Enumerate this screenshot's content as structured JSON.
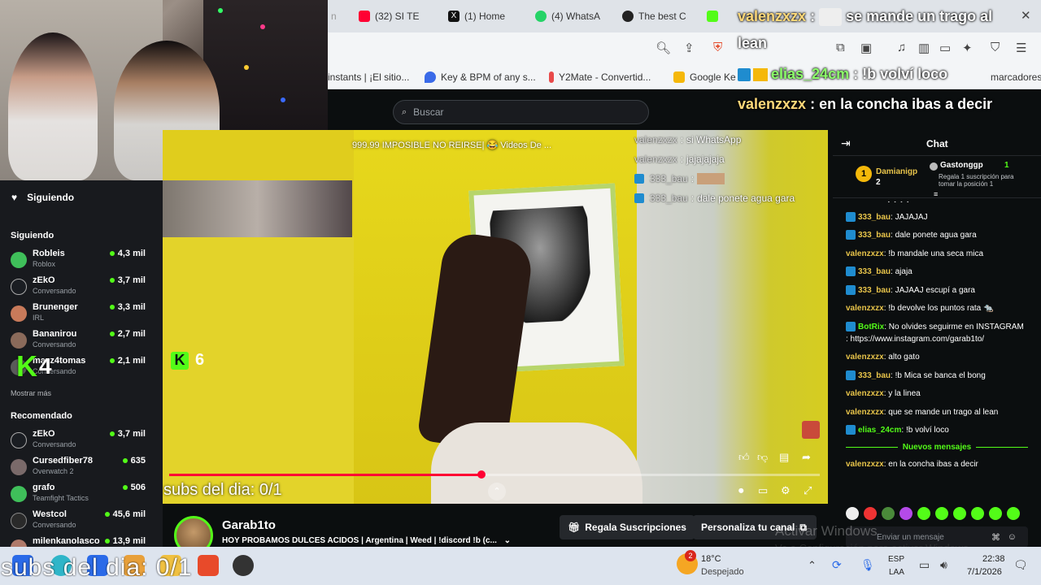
{
  "browser": {
    "tabs": [
      {
        "label": "(32) SI TE",
        "icon": "youtube-icon",
        "color": "#ff0033"
      },
      {
        "label": "(1) Home",
        "icon": "x-icon",
        "color": "#111111"
      },
      {
        "label": "(4) WhatsA",
        "icon": "whatsapp-icon",
        "color": "#25d366"
      },
      {
        "label": "The best C",
        "icon": "github-icon",
        "color": "#222222"
      }
    ],
    "bookmarks": [
      {
        "label": "rinstants | ¡El sitio..."
      },
      {
        "label": "Key & BPM of any s..."
      },
      {
        "label": "Y2Mate - Convertid..."
      },
      {
        "label": "Google Ke"
      },
      {
        "label": "marcadores"
      }
    ]
  },
  "kick": {
    "search_placeholder": "Buscar",
    "sidebar": {
      "following_header": "Siguiendo",
      "section_following": "Siguiendo",
      "following": [
        {
          "name": "Robleis",
          "sub": "Roblox",
          "viewers": "4,3 mil",
          "color": "#3fbf5a"
        },
        {
          "name": "zEkO",
          "sub": "Conversando",
          "viewers": "3,7 mil",
          "color": "#1a1d22"
        },
        {
          "name": "Brunenger",
          "sub": "IRL",
          "viewers": "3,3 mil",
          "color": "#c87a5a"
        },
        {
          "name": "Bananirou",
          "sub": "Conversando",
          "viewers": "2,7 mil",
          "color": "#8a6a5a"
        },
        {
          "name": "mazz4tomas",
          "sub": "Conversando",
          "viewers": "2,1 mil",
          "color": "#5a5a5a"
        }
      ],
      "show_more": "Mostrar más",
      "section_recommended": "Recomendado",
      "recommended": [
        {
          "name": "zEkO",
          "sub": "Conversando",
          "viewers": "3,7 mil",
          "color": "#1a1d22"
        },
        {
          "name": "Cursedfiber78",
          "sub": "Overwatch 2",
          "viewers": "635",
          "color": "#7a6a6a"
        },
        {
          "name": "grafo",
          "sub": "Teamfight Tactics",
          "viewers": "506",
          "color": "#3fbf5a"
        },
        {
          "name": "Westcol",
          "sub": "Conversando",
          "viewers": "45,6 mil",
          "color": "#2a2a2a"
        },
        {
          "name": "milenkanolasco",
          "sub": "",
          "viewers": "13,9 mil",
          "color": "#b07a6a"
        }
      ]
    },
    "video": {
      "title": "999.99 IMPOSIBLE NO REIRSE| 😂 Videos De ...",
      "overlay_chat": [
        {
          "user": "valenzxzx",
          "text": "si WhatsApp",
          "badge": false
        },
        {
          "user": "valenzxzx",
          "text": "jajajajaja",
          "badge": false
        },
        {
          "user": "333_bau",
          "text": "",
          "badge": true
        },
        {
          "user": "333_bau",
          "text": "dale ponete agua gara",
          "badge": true
        }
      ],
      "kick_badge_number": "6",
      "kick_badge_big_number": "4",
      "subs_day": "subs del dia: 0/1",
      "progress": 0.48
    },
    "streamer": {
      "name": "Garab1to",
      "title": "HOY PROBAMOS DULCES ACIDOS | Argentina | Weed | !discord !b (c..."
    },
    "buttons": {
      "gift_subs": "Regala Suscripciones",
      "customize": "Personaliza tu canal"
    },
    "chat": {
      "title": "Chat",
      "pinned": {
        "rank": "1",
        "user1": "Damianigp",
        "user1_count": "2",
        "user2": "Gastonggp",
        "user2_count": "1",
        "pinned_text": "Regala 1 suscripción para tomar la posición 1"
      },
      "messages": [
        {
          "user": "valenzxzx",
          "text": "jajajaja",
          "color": "#e8c44a",
          "badge": false
        },
        {
          "user": "333_bau",
          "text": "JAJAJAJ",
          "color": "#e8c44a",
          "badge": true
        },
        {
          "user": "333_bau",
          "text": "dale ponete agua gara",
          "color": "#e8c44a",
          "badge": true
        },
        {
          "user": "valenzxzx",
          "text": "!b mandale una seca mica",
          "color": "#e8c44a",
          "badge": false
        },
        {
          "user": "333_bau",
          "text": "ajaja",
          "color": "#e8c44a",
          "badge": true
        },
        {
          "user": "333_bau",
          "text": "JAJAAJ escupí a gara",
          "color": "#e8c44a",
          "badge": true
        },
        {
          "user": "valenzxzx",
          "text": "!b devolve los puntos rata 🐀",
          "color": "#e8c44a",
          "badge": false
        },
        {
          "user": "BotRix",
          "text": "No olvides seguirme en INSTAGRAM : https://www.instagram.com/garab1to/",
          "color": "#53fc18",
          "badge": true
        },
        {
          "user": "valenzxzx",
          "text": "alto gato",
          "color": "#e8c44a",
          "badge": false
        },
        {
          "user": "333_bau",
          "text": "!b Mica se banca el bong",
          "color": "#e8c44a",
          "badge": true
        },
        {
          "user": "valenzxzx",
          "text": "y la linea",
          "color": "#e8c44a",
          "badge": false
        },
        {
          "user": "valenzxzx",
          "text": "que se mande un trago al lean",
          "color": "#e8c44a",
          "badge": false
        },
        {
          "user": "elias_24cm",
          "text": "!b volví loco",
          "color": "#53fc18",
          "badge": true
        }
      ],
      "new_messages_label": "Nuevos mensajes",
      "last_message": {
        "user": "valenzxzx",
        "text": "en la concha ibas a decir"
      },
      "input_placeholder": "Enviar un mensaje"
    }
  },
  "obs_overlay": {
    "lines": [
      {
        "user": "valenzxzx",
        "text": "se mande un trago al"
      },
      {
        "user": "",
        "text": "lean"
      },
      {
        "user": "elias_24cm",
        "text": "!b volví loco"
      },
      {
        "user": "valenzxzx",
        "text": "en la concha ibas a decir"
      }
    ]
  },
  "windows": {
    "watermark_title": "Activar Windows",
    "watermark_sub": "Ve a Configuración para activar Windows.",
    "weather_temp": "18°C",
    "weather_desc": "Despejado",
    "weather_badge": "2",
    "lang_top": "ESP",
    "lang_bottom": "LAA",
    "time": "22:38",
    "date": "7/1/2026",
    "subs_overlay": "subs del dia: 0/1"
  },
  "colors": {
    "kick_green": "#53fc18",
    "video_yellow": "#e0cd1d",
    "chat_bg": "#0b0e0f"
  }
}
